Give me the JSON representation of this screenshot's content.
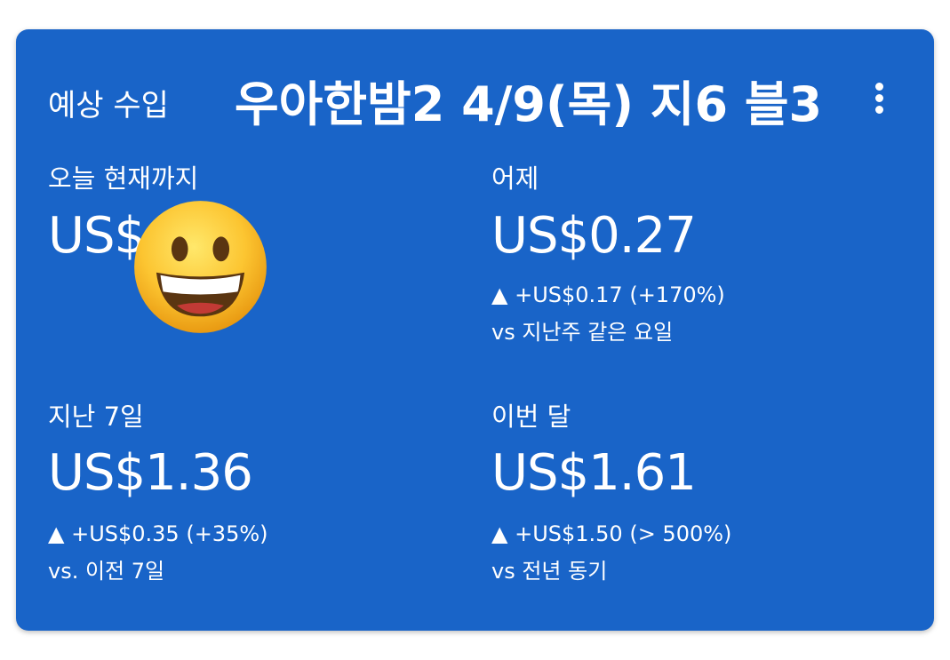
{
  "card": {
    "title": "예상 수입",
    "overlay_title": "우아한밤2 4/9(목)  지6 블3",
    "more_icon": "more-vertical-icon",
    "background_color": "#1964c8"
  },
  "metrics": {
    "today": {
      "label": "오늘 현재까지",
      "value": "US$"
    },
    "yesterday": {
      "label": "어제",
      "value": "US$0.27",
      "change": "▲ +US$0.17 (+170%)",
      "compare": "vs 지난주 같은 요일"
    },
    "last7": {
      "label": "지난 7일",
      "value": "US$1.36",
      "change": "▲ +US$0.35 (+35%)",
      "compare": "vs. 이전 7일"
    },
    "this_month": {
      "label": "이번 달",
      "value": "US$1.61",
      "change": "▲ +US$1.50 (> 500%)",
      "compare": "vs 전년 동기"
    }
  },
  "sticker": {
    "icon": "grinning-face-emoji-icon"
  }
}
